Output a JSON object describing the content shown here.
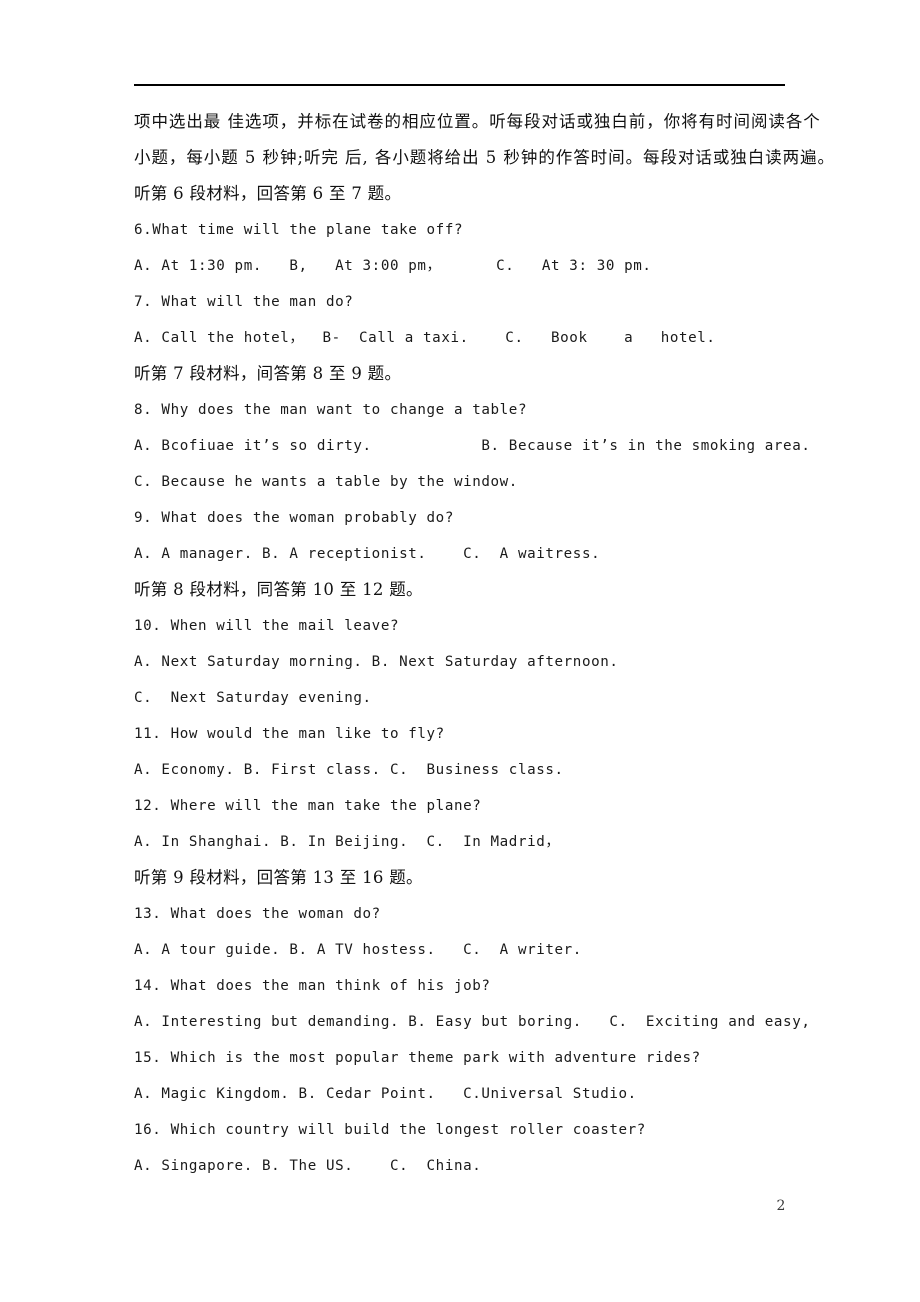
{
  "document": {
    "page_number": "2",
    "header_rule": true
  },
  "body": {
    "lines": [
      {
        "id": "instruction-line-1",
        "script": "cn-just",
        "text": "项中选出最 佳选项，并标在试卷的相应位置。听每段对话或独白前，你将有时间阅读各个"
      },
      {
        "id": "instruction-line-2",
        "script": "cn-just",
        "text": "小题，每小题 5 秒钟;听完 后, 各小题将给出 5 秒钟的作答时间。每段对话或独白读两遍。"
      },
      {
        "id": "section-heading-material-6",
        "script": "cn",
        "text": "听第 6 段材料，回答第 6 至 7 题。"
      },
      {
        "id": "question-6",
        "script": "en",
        "text": "6.What time will the plane take off?"
      },
      {
        "id": "question-6-options",
        "script": "en",
        "text": "A. At 1:30 pm.   B,   At 3:00 pm，      C.   At 3: 30 pm."
      },
      {
        "id": "question-7",
        "script": "en",
        "text": "7. What will the man do?"
      },
      {
        "id": "question-7-options",
        "script": "en",
        "text": "A. Call the hotel，  B-  Call a taxi.    C.   Book    a   hotel."
      },
      {
        "id": "section-heading-material-7",
        "script": "cn",
        "text": "听第 7 段材料，间答第 8 至 9 题。"
      },
      {
        "id": "question-8",
        "script": "en",
        "text": "8. Why does the man want to change a table?"
      },
      {
        "id": "question-8-options-line-1",
        "script": "en",
        "text": "A. Bcofiuae it’s so dirty.            B. Because it’s in the smoking area."
      },
      {
        "id": "question-8-options-line-2",
        "script": "en",
        "text": "C. Because he wants a table by the window."
      },
      {
        "id": "question-9",
        "script": "en",
        "text": "9. What does the woman probably do?"
      },
      {
        "id": "question-9-options",
        "script": "en",
        "text": "A. A manager. B. A receptionist.    C.  A waitress."
      },
      {
        "id": "section-heading-material-8",
        "script": "cn",
        "text": "听第 8 段材料，同答第 10 至 12 题。"
      },
      {
        "id": "question-10",
        "script": "en",
        "text": "10. When will the mail leave?"
      },
      {
        "id": "question-10-options-line-1",
        "script": "en",
        "text": "A. Next Saturday morning. B. Next Saturday afternoon."
      },
      {
        "id": "question-10-options-line-2",
        "script": "en",
        "text": "C.  Next Saturday evening."
      },
      {
        "id": "question-11",
        "script": "en",
        "text": "11. How would the man like to fly?"
      },
      {
        "id": "question-11-options",
        "script": "en",
        "text": "A. Economy. B. First class. C.  Business class."
      },
      {
        "id": "question-12",
        "script": "en",
        "text": "12. Where will the man take the plane?"
      },
      {
        "id": "question-12-options",
        "script": "en",
        "text": "A. In Shanghai. B. In Beijing.  C.  In Madrid，"
      },
      {
        "id": "section-heading-material-9",
        "script": "cn",
        "text": "听第 9 段材料，回答第 13 至 16 题。"
      },
      {
        "id": "question-13",
        "script": "en",
        "text": "13. What does the woman do?"
      },
      {
        "id": "question-13-options",
        "script": "en",
        "text": "A. A tour guide. B. A TV hostess.   C.  A writer."
      },
      {
        "id": "question-14",
        "script": "en",
        "text": "14. What does the man think of his job?"
      },
      {
        "id": "question-14-options",
        "script": "en",
        "text": "A. Interesting but demanding. B. Easy but boring.   C.  Exciting and easy,"
      },
      {
        "id": "question-15",
        "script": "en",
        "text": "15. Which is the most popular theme park with adventure rides?"
      },
      {
        "id": "question-15-options",
        "script": "en",
        "text": "A. Magic Kingdom. B. Cedar Point.   C.Universal Studio."
      },
      {
        "id": "question-16",
        "script": "en",
        "text": "16. Which country will build the longest roller coaster?"
      },
      {
        "id": "question-16-options",
        "script": "en",
        "text": "A. Singapore. B. The US.    C.  China."
      }
    ]
  }
}
